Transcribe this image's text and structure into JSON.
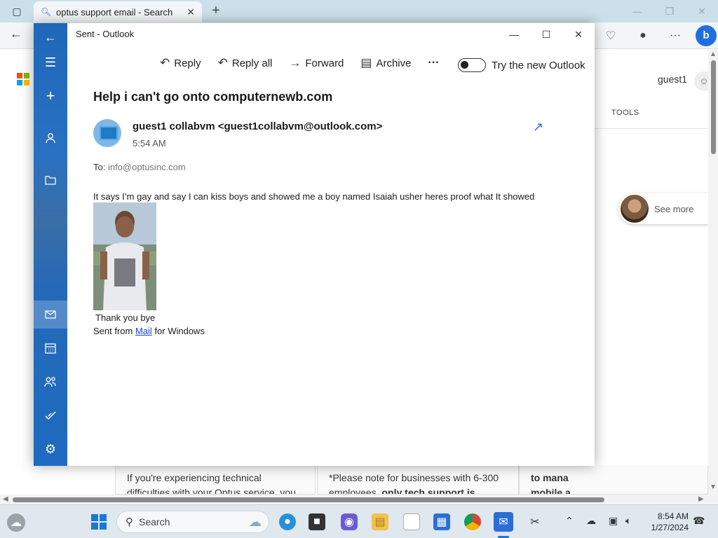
{
  "browser": {
    "tab_title": "optus support email - Search",
    "guest_label": "guest1",
    "tools_label": "TOOLS",
    "see_more": "See more",
    "cards": [
      {
        "line1": "If you're experiencing technical",
        "line2": "difficulties with your Optus service, you"
      },
      {
        "line1": "*Please note for businesses with 6-300",
        "line2_prefix": "employees, ",
        "line2_bold": "only tech support is"
      },
      {
        "line1": "to mana",
        "line2": "mobile a"
      }
    ]
  },
  "mail": {
    "window_title": "Sent - Outlook",
    "commands": {
      "reply": "Reply",
      "reply_all": "Reply all",
      "forward": "Forward",
      "archive": "Archive",
      "more": "···"
    },
    "new_outlook_label": "Try the new Outlook",
    "subject": "Help i can't go onto computernewb.com",
    "sender": "guest1 collabvm <guest1collabvm@outlook.com>",
    "time": "5:54 AM",
    "to_label": "To:",
    "to_address": "info@optusinc.com",
    "body": "It says I’m gay and say I can kiss boys and showed me a boy named Isaiah usher heres proof what It showed",
    "closing": "Thank you bye",
    "signature_prefix": "Sent from ",
    "signature_link": "Mail",
    "signature_suffix": " for Windows"
  },
  "taskbar": {
    "search_placeholder": "Search",
    "time": "8:54 AM",
    "date": "1/27/2024"
  },
  "colors": {
    "rail_blue": "#1f67b8",
    "accent_blue": "#2a6fd6",
    "link_blue": "#1a47c8"
  }
}
